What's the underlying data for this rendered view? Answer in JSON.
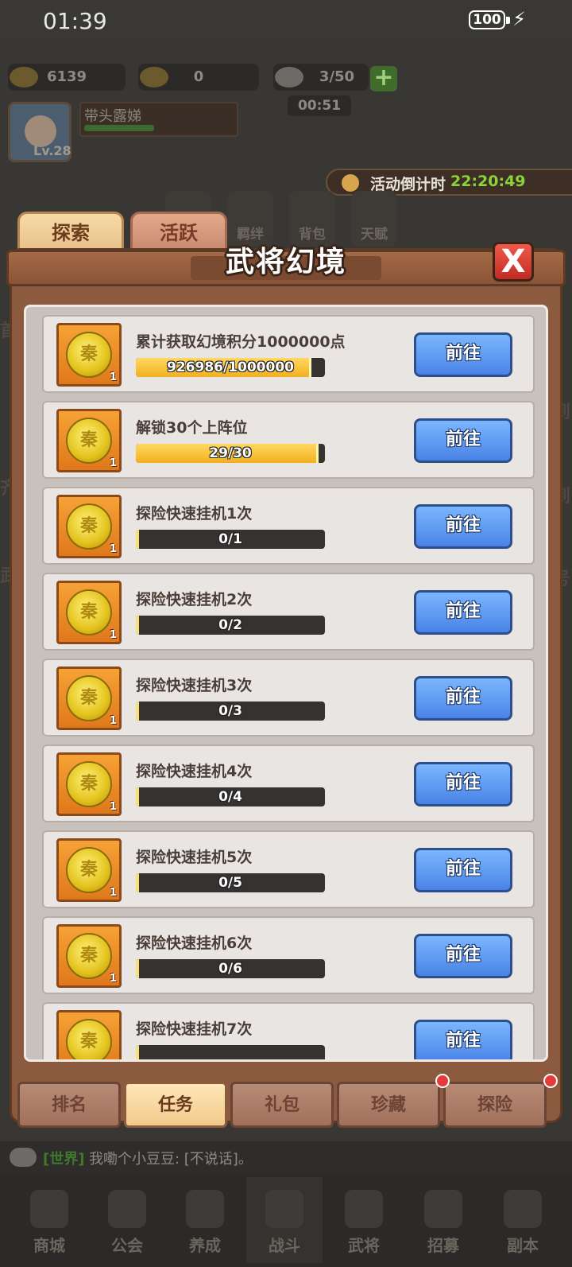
{
  "status_bar": {
    "time": "01:39",
    "battery": "100"
  },
  "resources": {
    "gold": "6139",
    "tickets": "0",
    "stamina": "3/50",
    "stamina_timer": "00:51"
  },
  "player": {
    "name": "带头露娣",
    "level": "Lv.28"
  },
  "event": {
    "label": "活动倒计时",
    "time": "22:20:49"
  },
  "bg_icons": [
    "羁绊",
    "背包",
    "天赋"
  ],
  "bg_edge_glyphs": [
    "首",
    "齐",
    "武",
    "到",
    "到",
    "号"
  ],
  "top_tabs": [
    "探索",
    "活跃"
  ],
  "panel": {
    "title": "武将幻境",
    "close": "X"
  },
  "tasks": [
    {
      "name": "累计获取幻境积分1000000点",
      "progress_text": "926986/1000000",
      "progress": 0.927,
      "reward_count": "1",
      "button": "前往"
    },
    {
      "name": "解锁30个上阵位",
      "progress_text": "29/30",
      "progress": 0.967,
      "reward_count": "1",
      "button": "前往"
    },
    {
      "name": "探险快速挂机1次",
      "progress_text": "0/1",
      "progress": 0,
      "reward_count": "1",
      "button": "前往"
    },
    {
      "name": "探险快速挂机2次",
      "progress_text": "0/2",
      "progress": 0,
      "reward_count": "1",
      "button": "前往"
    },
    {
      "name": "探险快速挂机3次",
      "progress_text": "0/3",
      "progress": 0,
      "reward_count": "1",
      "button": "前往"
    },
    {
      "name": "探险快速挂机4次",
      "progress_text": "0/4",
      "progress": 0,
      "reward_count": "1",
      "button": "前往"
    },
    {
      "name": "探险快速挂机5次",
      "progress_text": "0/5",
      "progress": 0,
      "reward_count": "1",
      "button": "前往"
    },
    {
      "name": "探险快速挂机6次",
      "progress_text": "0/6",
      "progress": 0,
      "reward_count": "1",
      "button": "前往"
    },
    {
      "name": "探险快速挂机7次",
      "progress_text": "",
      "progress": 0,
      "reward_count": "",
      "button": "前往"
    }
  ],
  "bottom_tabs": [
    "排名",
    "任务",
    "礼包",
    "珍藏",
    "探险"
  ],
  "active_bottom_tab": "任务",
  "chat": {
    "channel": "[世界]",
    "message": "我嘞个小豆豆: [不说话]。"
  },
  "nav": [
    "商城",
    "公会",
    "养成",
    "战斗",
    "武将",
    "招募",
    "副本"
  ],
  "coin_glyph": "秦"
}
